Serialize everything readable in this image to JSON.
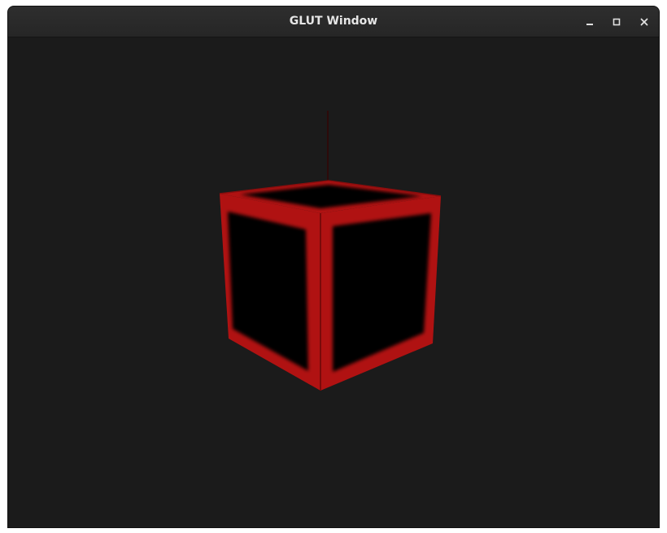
{
  "window": {
    "title": "GLUT Window",
    "controls": {
      "minimize_icon": "minimize-icon",
      "maximize_icon": "maximize-icon",
      "close_icon": "close-icon"
    }
  },
  "scene": {
    "background_color": "#1b1b1b",
    "cube_edge_color": "#b01212",
    "cube_face_color": "#000000",
    "axis_line_color": "#3a0000"
  }
}
